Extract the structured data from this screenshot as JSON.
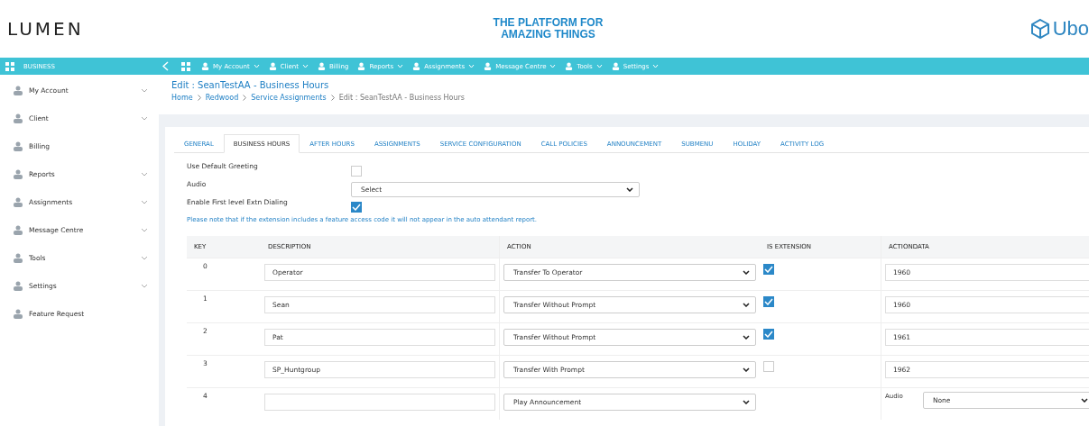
{
  "header": {
    "logo": "LUMEN",
    "tagline": [
      "THE PLATFORM FOR",
      "AMAZING THINGS"
    ],
    "right_logo": "Ubo"
  },
  "navbar": {
    "section": "BUSINESS",
    "items": [
      {
        "label": "My Account",
        "dropdown": true
      },
      {
        "label": "Client",
        "dropdown": true
      },
      {
        "label": "Billing",
        "dropdown": false
      },
      {
        "label": "Reports",
        "dropdown": true
      },
      {
        "label": "Assignments",
        "dropdown": true
      },
      {
        "label": "Message Centre",
        "dropdown": true
      },
      {
        "label": "Tools",
        "dropdown": true
      },
      {
        "label": "Settings",
        "dropdown": true
      }
    ]
  },
  "sidebar": {
    "items": [
      {
        "label": "My Account",
        "expandable": true
      },
      {
        "label": "Client",
        "expandable": true
      },
      {
        "label": "Billing",
        "expandable": false
      },
      {
        "label": "Reports",
        "expandable": true
      },
      {
        "label": "Assignments",
        "expandable": true
      },
      {
        "label": "Message Centre",
        "expandable": true
      },
      {
        "label": "Tools",
        "expandable": true
      },
      {
        "label": "Settings",
        "expandable": true
      },
      {
        "label": "Feature Request",
        "expandable": false
      }
    ]
  },
  "page": {
    "title": "Edit : SeanTestAA - Business Hours",
    "breadcrumb": [
      "Home",
      "Redwood",
      "Service Assignments",
      "Edit : SeanTestAA - Business Hours"
    ]
  },
  "tabs": [
    {
      "label": "GENERAL",
      "selected": false
    },
    {
      "label": "BUSINESS HOURS",
      "selected": true
    },
    {
      "label": "AFTER HOURS",
      "selected": false
    },
    {
      "label": "ASSIGNMENTS",
      "selected": false
    },
    {
      "label": "SERVICE CONFIGURATION",
      "selected": false
    },
    {
      "label": "CALL POLICIES",
      "selected": false
    },
    {
      "label": "ANNOUNCEMENT",
      "selected": false
    },
    {
      "label": "SUBMENU",
      "selected": false
    },
    {
      "label": "HOLIDAY",
      "selected": false
    },
    {
      "label": "ACTIVITY LOG",
      "selected": false
    }
  ],
  "form": {
    "default_greeting": {
      "label": "Use Default Greeting",
      "checked": false
    },
    "audio": {
      "label": "Audio",
      "value": "Select"
    },
    "first_level": {
      "label": "Enable First level Extn Dialing",
      "checked": true
    },
    "note": "Please note that if the extension includes a feature access code it will not appear in the auto attendant report."
  },
  "table": {
    "columns": [
      "KEY",
      "DESCRIPTION",
      "ACTION",
      "IS EXTENSION",
      "ACTIONDATA"
    ],
    "rows": [
      {
        "key": "0",
        "description": "Operator",
        "action": "Transfer To Operator",
        "kind": "extension",
        "is_extension": true,
        "actiondata": "1960"
      },
      {
        "key": "1",
        "description": "Sean",
        "action": "Transfer Without Prompt",
        "kind": "extension",
        "is_extension": true,
        "actiondata": "1960"
      },
      {
        "key": "2",
        "description": "Pat",
        "action": "Transfer Without Prompt",
        "kind": "extension",
        "is_extension": true,
        "actiondata": "1961"
      },
      {
        "key": "3",
        "description": "SP_Huntgroup",
        "action": "Transfer With Prompt",
        "kind": "extension",
        "is_extension": false,
        "actiondata": "1962"
      },
      {
        "key": "4",
        "description": "",
        "action": "Play Announcement",
        "kind": "audio",
        "audio_label": "Audio",
        "audio_value": "None"
      }
    ]
  }
}
